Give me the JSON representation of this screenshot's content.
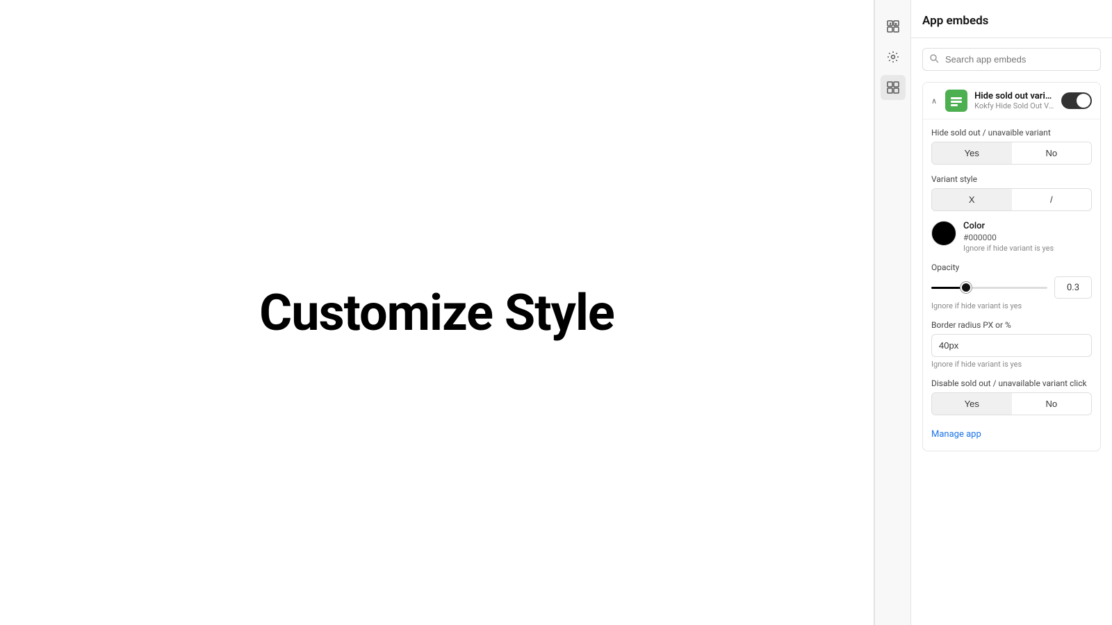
{
  "canvas": {
    "title": "Customize Style"
  },
  "panel": {
    "header": "App embeds",
    "search_placeholder": "Search app embeds",
    "embed_item": {
      "name": "Hide sold out variant",
      "subtitle": "Kokfy Hide Sold Out Varia...",
      "toggle_on": true
    },
    "settings": {
      "hide_label": "Hide sold out / unavaible variant",
      "hide_yes": "Yes",
      "hide_no": "No",
      "variant_style_label": "Variant style",
      "variant_x": "X",
      "variant_slash": "/",
      "color_label": "Color",
      "color_hex": "#000000",
      "color_hint": "Ignore if hide variant is yes",
      "opacity_label": "Opacity",
      "opacity_value": "0.3",
      "opacity_hint": "Ignore if hide variant is yes",
      "border_radius_label": "Border radius PX or %",
      "border_radius_value": "40px",
      "border_radius_hint": "Ignore if hide variant is yes",
      "disable_label": "Disable sold out / unavailable variant click",
      "disable_yes": "Yes",
      "disable_no": "No",
      "manage_app": "Manage app"
    }
  },
  "icons": {
    "rail_icon1": "⊟",
    "rail_icon2": "⚙",
    "rail_icon3": "⊞",
    "search": "🔍",
    "chevron_down": "∧",
    "embed_icon": "≡"
  }
}
